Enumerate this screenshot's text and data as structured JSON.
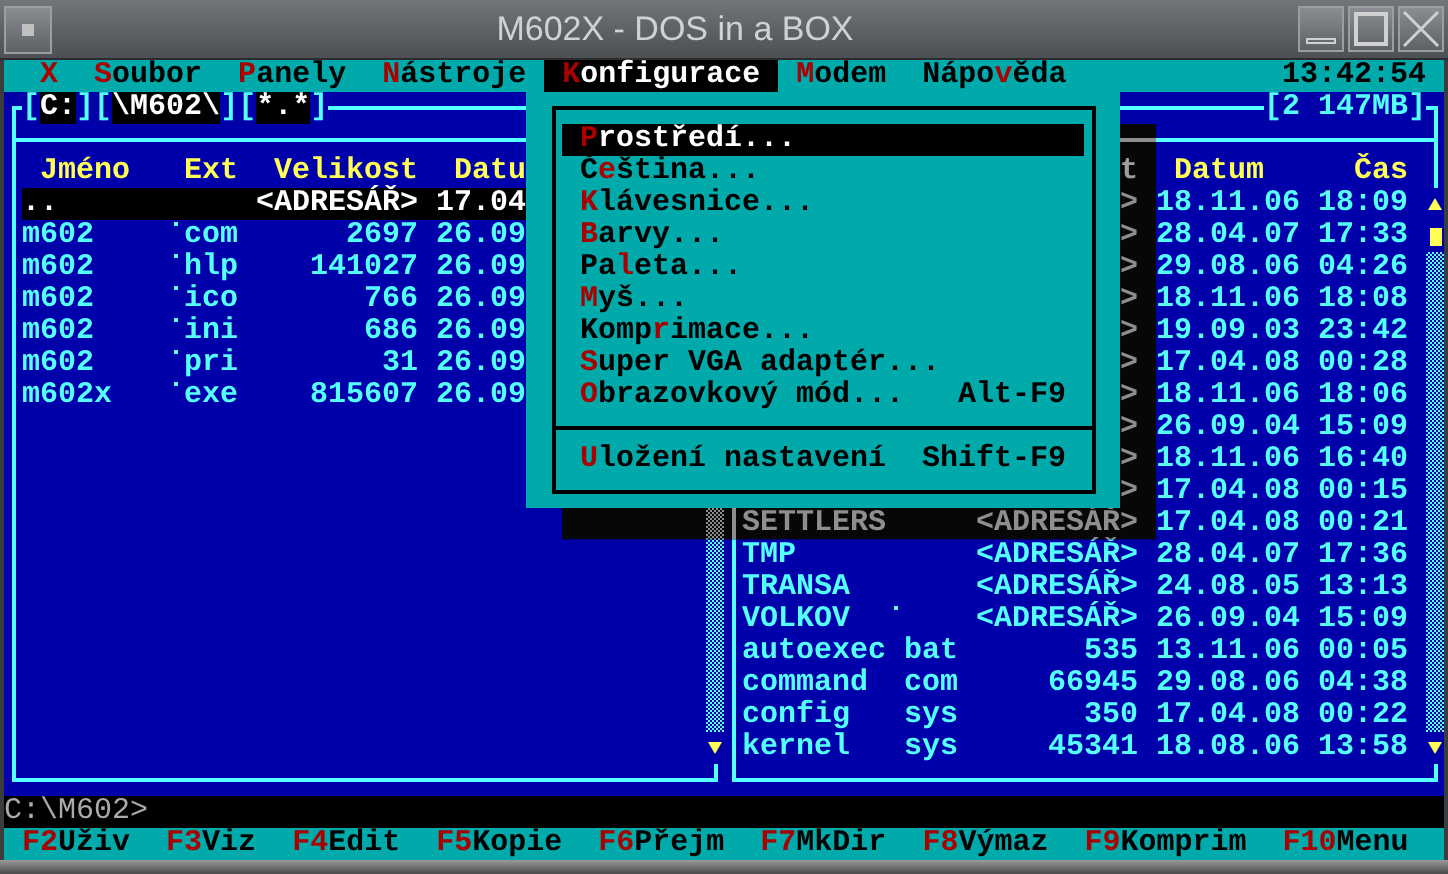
{
  "window": {
    "title": "M602X - DOS in a BOX"
  },
  "menu_bar": {
    "items": [
      {
        "key": "X",
        "selected": false
      },
      {
        "key": "S",
        "post": "oubor",
        "selected": false
      },
      {
        "key": "P",
        "post": "anely",
        "selected": false
      },
      {
        "key": "N",
        "post": "ástroje",
        "selected": false
      },
      {
        "key": "K",
        "post": "onfigurace",
        "selected": true
      },
      {
        "key": "M",
        "post": "odem",
        "selected": false
      },
      {
        "pre": "Nápo",
        "key": "v",
        "post": "ěda",
        "selected": false
      }
    ],
    "clock": "13:42:54"
  },
  "left_panel": {
    "title_parts": [
      {
        "kind": "bracket",
        "text": "["
      },
      {
        "kind": "field",
        "text": "C:"
      },
      {
        "kind": "bracket",
        "text": "]["
      },
      {
        "kind": "field",
        "text": "\\M602\\"
      },
      {
        "kind": "bracket",
        "text": "]["
      },
      {
        "kind": "field",
        "text": "*.*"
      },
      {
        "kind": "bracket",
        "text": "]"
      }
    ],
    "columns": {
      "name": "Jméno",
      "ext": "Ext",
      "size": "Velikost",
      "date": "Datu"
    },
    "rows": [
      {
        "name": "..",
        "size": "<ADRESÁŘ>",
        "date": "17.04",
        "marked": false,
        "selected": true
      },
      {
        "name": "m602",
        "ext": "com",
        "size": "2697",
        "date": "26.09",
        "marked": true,
        "selected": false
      },
      {
        "name": "m602",
        "ext": "hlp",
        "size": "141027",
        "date": "26.09",
        "marked": true,
        "selected": false
      },
      {
        "name": "m602",
        "ext": "ico",
        "size": "766",
        "date": "26.09",
        "marked": true,
        "selected": false
      },
      {
        "name": "m602",
        "ext": "ini",
        "size": "686",
        "date": "26.09",
        "marked": true,
        "selected": false
      },
      {
        "name": "m602",
        "ext": "pri",
        "size": "31",
        "date": "26.09",
        "marked": true,
        "selected": false
      },
      {
        "name": "m602x",
        "ext": "exe",
        "size": "815607",
        "date": "26.09",
        "marked": true,
        "selected": false
      }
    ]
  },
  "right_panel": {
    "title": "[2 147MB]",
    "columns": {
      "size": "t",
      "date": "Datum",
      "time": "Čas"
    },
    "rows": [
      {
        "size": ">",
        "date": "18.11.06",
        "time": "18:09",
        "selected": false
      },
      {
        "size": ">",
        "date": "28.04.07",
        "time": "17:33",
        "selected": false
      },
      {
        "size": ">",
        "date": "29.08.06",
        "time": "04:26",
        "selected": false
      },
      {
        "size": ">",
        "date": "18.11.06",
        "time": "18:08",
        "selected": false
      },
      {
        "size": ">",
        "date": "19.09.03",
        "time": "23:42",
        "selected": false
      },
      {
        "size": ">",
        "date": "17.04.08",
        "time": "00:28",
        "selected": false
      },
      {
        "size": ">",
        "date": "18.11.06",
        "time": "18:06",
        "selected": false
      },
      {
        "size": ">",
        "date": "26.09.04",
        "time": "15:09",
        "selected": false
      },
      {
        "size": ">",
        "date": "18.11.06",
        "time": "16:40",
        "selected": false
      },
      {
        "size": ">",
        "date": "17.04.08",
        "time": "00:15",
        "selected": false
      },
      {
        "name": "SETTLERS",
        "size": "<ADRESÁŘ>",
        "date": "17.04.08",
        "time": "00:21",
        "marked": false,
        "selected": false
      },
      {
        "name": "TMP",
        "size": "<ADRESÁŘ>",
        "date": "28.04.07",
        "time": "17:36",
        "marked": false,
        "selected": false
      },
      {
        "name": "TRANSA",
        "size": "<ADRESÁŘ>",
        "date": "24.08.05",
        "time": "13:13",
        "marked": false,
        "selected": false
      },
      {
        "name": "VOLKOV",
        "size": "<ADRESÁŘ>",
        "date": "26.09.04",
        "time": "15:09",
        "marked": true,
        "selected": false
      },
      {
        "name": "autoexec",
        "ext": "bat",
        "size": "535",
        "date": "13.11.06",
        "time": "00:05",
        "marked": false,
        "selected": false
      },
      {
        "name": "command",
        "ext": "com",
        "size": "66945",
        "date": "29.08.06",
        "time": "04:38",
        "marked": false,
        "selected": false
      },
      {
        "name": "config",
        "ext": "sys",
        "size": "350",
        "date": "17.04.08",
        "time": "00:22",
        "marked": false,
        "selected": false
      },
      {
        "name": "kernel",
        "ext": "sys",
        "size": "45341",
        "date": "18.08.06",
        "time": "13:58",
        "marked": false,
        "selected": false
      }
    ]
  },
  "dropdown": {
    "items": [
      {
        "kind": "item",
        "key": "P",
        "post": "rostředí...",
        "selected": true
      },
      {
        "kind": "item",
        "pre": "Č",
        "key": "e",
        "post": "ština...",
        "selected": false
      },
      {
        "kind": "item",
        "key": "K",
        "post": "lávesnice...",
        "selected": false
      },
      {
        "kind": "item",
        "key": "B",
        "post": "arvy...",
        "selected": false
      },
      {
        "kind": "item",
        "pre": "Pa",
        "key": "l",
        "post": "eta...",
        "selected": false
      },
      {
        "kind": "item",
        "key": "M",
        "post": "yš...",
        "selected": false
      },
      {
        "kind": "item",
        "pre": "Komp",
        "key": "r",
        "post": "imace...",
        "selected": false
      },
      {
        "kind": "item",
        "key": "S",
        "post": "uper VGA adaptér...",
        "selected": false
      },
      {
        "kind": "item",
        "key": "O",
        "post": "brazovkový mód...",
        "shortcut": "Alt-F9",
        "selected": false
      },
      {
        "kind": "separator"
      },
      {
        "kind": "item",
        "key": "U",
        "post": "ložení nastavení",
        "shortcut": "Shift-F9",
        "selected": false
      }
    ]
  },
  "command_line": "C:\\M602>",
  "function_keys": [
    {
      "key": "F2",
      "label": "Uživ"
    },
    {
      "key": "F3",
      "label": "Viz"
    },
    {
      "key": "F4",
      "label": "Edit"
    },
    {
      "key": "F5",
      "label": "Kopie"
    },
    {
      "key": "F6",
      "label": "Přejm"
    },
    {
      "key": "F7",
      "label": "MkDir"
    },
    {
      "key": "F8",
      "label": "Výmaz"
    },
    {
      "key": "F9",
      "label": "Komprim"
    },
    {
      "key": "F10",
      "label": "Menu"
    }
  ]
}
